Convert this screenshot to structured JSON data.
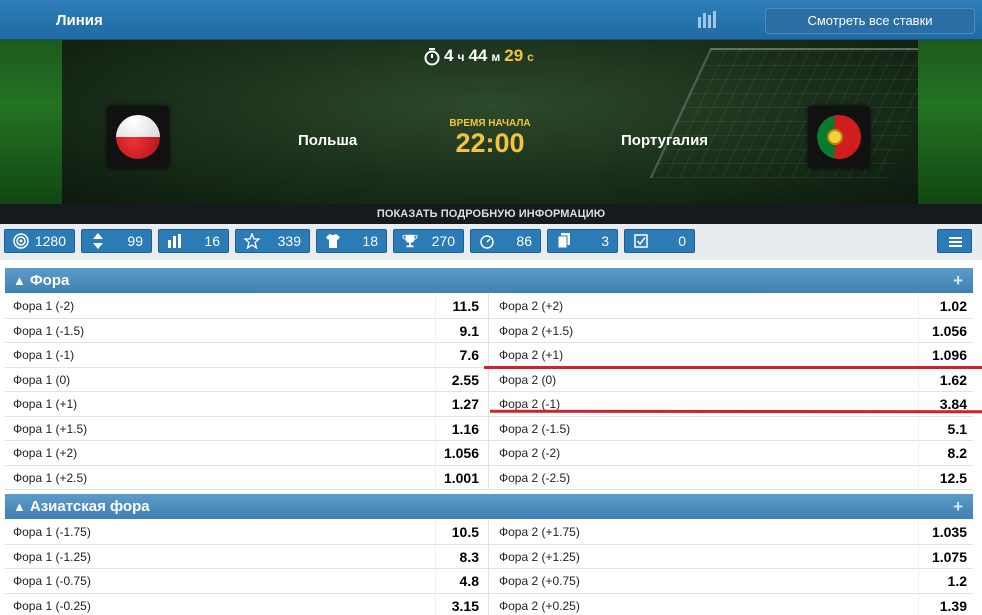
{
  "header": {
    "title": "Линия",
    "all_bets_label": "Смотреть все ставки"
  },
  "match": {
    "timer": {
      "hours": "4",
      "hours_unit": "ч",
      "minutes": "44",
      "minutes_unit": "м",
      "seconds": "29",
      "seconds_unit": "с"
    },
    "home": "Польша",
    "away": "Португалия",
    "start_label": "ВРЕМЯ НАЧАЛА",
    "start_time": "22:00",
    "details_label": "ПОКАЗАТЬ ПОДРОБНУЮ ИНФОРМАЦИЮ"
  },
  "stats": [
    {
      "icon": "target-icon",
      "value": "1280"
    },
    {
      "icon": "sort-arrows-icon",
      "value": "99"
    },
    {
      "icon": "bars-chart-icon",
      "value": "16"
    },
    {
      "icon": "star-icon",
      "value": "339"
    },
    {
      "icon": "shirt-icon",
      "value": "18"
    },
    {
      "icon": "trophy-icon",
      "value": "270"
    },
    {
      "icon": "stopwatch-icon",
      "value": "86"
    },
    {
      "icon": "cards-icon",
      "value": "3"
    },
    {
      "icon": "checkbox-icon",
      "value": "0"
    }
  ],
  "sections": [
    {
      "title": "Фора",
      "rows": [
        {
          "l_label": "Фора 1 (-2)",
          "l_odd": "11.5",
          "r_label": "Фора 2 (+2)",
          "r_odd": "1.02"
        },
        {
          "l_label": "Фора 1 (-1.5)",
          "l_odd": "9.1",
          "r_label": "Фора 2 (+1.5)",
          "r_odd": "1.056"
        },
        {
          "l_label": "Фора 1 (-1)",
          "l_odd": "7.6",
          "r_label": "Фора 2 (+1)",
          "r_odd": "1.096"
        },
        {
          "l_label": "Фора 1 (0)",
          "l_odd": "2.55",
          "r_label": "Фора 2 (0)",
          "r_odd": "1.62"
        },
        {
          "l_label": "Фора 1 (+1)",
          "l_odd": "1.27",
          "r_label": "Фора 2 (-1)",
          "r_odd": "3.84"
        },
        {
          "l_label": "Фора 1 (+1.5)",
          "l_odd": "1.16",
          "r_label": "Фора 2 (-1.5)",
          "r_odd": "5.1"
        },
        {
          "l_label": "Фора 1 (+2)",
          "l_odd": "1.056",
          "r_label": "Фора 2 (-2)",
          "r_odd": "8.2"
        },
        {
          "l_label": "Фора 1 (+2.5)",
          "l_odd": "1.001",
          "r_label": "Фора 2 (-2.5)",
          "r_odd": "12.5"
        }
      ]
    },
    {
      "title": "Азиатская фора",
      "rows": [
        {
          "l_label": "Фора 1 (-1.75)",
          "l_odd": "10.5",
          "r_label": "Фора 2 (+1.75)",
          "r_odd": "1.035"
        },
        {
          "l_label": "Фора 1 (-1.25)",
          "l_odd": "8.3",
          "r_label": "Фора 2 (+1.25)",
          "r_odd": "1.075"
        },
        {
          "l_label": "Фора 1 (-0.75)",
          "l_odd": "4.8",
          "r_label": "Фора 2 (+0.75)",
          "r_odd": "1.2"
        },
        {
          "l_label": "Фора 1 (-0.25)",
          "l_odd": "3.15",
          "r_label": "Фора 2 (+0.25)",
          "r_odd": "1.39"
        }
      ]
    }
  ],
  "colors": {
    "header_blue": "#2f7fb8",
    "accent_yellow": "#f3c43b",
    "highlight_red": "#d4202a"
  }
}
